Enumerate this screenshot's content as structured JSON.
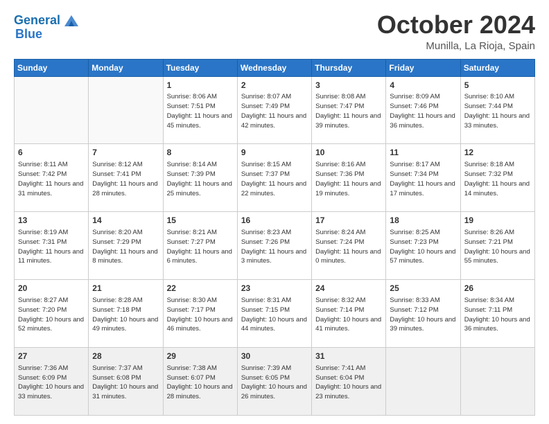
{
  "logo": {
    "line1": "General",
    "line2": "Blue"
  },
  "header": {
    "month": "October 2024",
    "location": "Munilla, La Rioja, Spain"
  },
  "weekdays": [
    "Sunday",
    "Monday",
    "Tuesday",
    "Wednesday",
    "Thursday",
    "Friday",
    "Saturday"
  ],
  "weeks": [
    [
      {
        "day": "",
        "info": ""
      },
      {
        "day": "",
        "info": ""
      },
      {
        "day": "1",
        "info": "Sunrise: 8:06 AM\nSunset: 7:51 PM\nDaylight: 11 hours\nand 45 minutes."
      },
      {
        "day": "2",
        "info": "Sunrise: 8:07 AM\nSunset: 7:49 PM\nDaylight: 11 hours\nand 42 minutes."
      },
      {
        "day": "3",
        "info": "Sunrise: 8:08 AM\nSunset: 7:47 PM\nDaylight: 11 hours\nand 39 minutes."
      },
      {
        "day": "4",
        "info": "Sunrise: 8:09 AM\nSunset: 7:46 PM\nDaylight: 11 hours\nand 36 minutes."
      },
      {
        "day": "5",
        "info": "Sunrise: 8:10 AM\nSunset: 7:44 PM\nDaylight: 11 hours\nand 33 minutes."
      }
    ],
    [
      {
        "day": "6",
        "info": "Sunrise: 8:11 AM\nSunset: 7:42 PM\nDaylight: 11 hours\nand 31 minutes."
      },
      {
        "day": "7",
        "info": "Sunrise: 8:12 AM\nSunset: 7:41 PM\nDaylight: 11 hours\nand 28 minutes."
      },
      {
        "day": "8",
        "info": "Sunrise: 8:14 AM\nSunset: 7:39 PM\nDaylight: 11 hours\nand 25 minutes."
      },
      {
        "day": "9",
        "info": "Sunrise: 8:15 AM\nSunset: 7:37 PM\nDaylight: 11 hours\nand 22 minutes."
      },
      {
        "day": "10",
        "info": "Sunrise: 8:16 AM\nSunset: 7:36 PM\nDaylight: 11 hours\nand 19 minutes."
      },
      {
        "day": "11",
        "info": "Sunrise: 8:17 AM\nSunset: 7:34 PM\nDaylight: 11 hours\nand 17 minutes."
      },
      {
        "day": "12",
        "info": "Sunrise: 8:18 AM\nSunset: 7:32 PM\nDaylight: 11 hours\nand 14 minutes."
      }
    ],
    [
      {
        "day": "13",
        "info": "Sunrise: 8:19 AM\nSunset: 7:31 PM\nDaylight: 11 hours\nand 11 minutes."
      },
      {
        "day": "14",
        "info": "Sunrise: 8:20 AM\nSunset: 7:29 PM\nDaylight: 11 hours\nand 8 minutes."
      },
      {
        "day": "15",
        "info": "Sunrise: 8:21 AM\nSunset: 7:27 PM\nDaylight: 11 hours\nand 6 minutes."
      },
      {
        "day": "16",
        "info": "Sunrise: 8:23 AM\nSunset: 7:26 PM\nDaylight: 11 hours\nand 3 minutes."
      },
      {
        "day": "17",
        "info": "Sunrise: 8:24 AM\nSunset: 7:24 PM\nDaylight: 11 hours\nand 0 minutes."
      },
      {
        "day": "18",
        "info": "Sunrise: 8:25 AM\nSunset: 7:23 PM\nDaylight: 10 hours\nand 57 minutes."
      },
      {
        "day": "19",
        "info": "Sunrise: 8:26 AM\nSunset: 7:21 PM\nDaylight: 10 hours\nand 55 minutes."
      }
    ],
    [
      {
        "day": "20",
        "info": "Sunrise: 8:27 AM\nSunset: 7:20 PM\nDaylight: 10 hours\nand 52 minutes."
      },
      {
        "day": "21",
        "info": "Sunrise: 8:28 AM\nSunset: 7:18 PM\nDaylight: 10 hours\nand 49 minutes."
      },
      {
        "day": "22",
        "info": "Sunrise: 8:30 AM\nSunset: 7:17 PM\nDaylight: 10 hours\nand 46 minutes."
      },
      {
        "day": "23",
        "info": "Sunrise: 8:31 AM\nSunset: 7:15 PM\nDaylight: 10 hours\nand 44 minutes."
      },
      {
        "day": "24",
        "info": "Sunrise: 8:32 AM\nSunset: 7:14 PM\nDaylight: 10 hours\nand 41 minutes."
      },
      {
        "day": "25",
        "info": "Sunrise: 8:33 AM\nSunset: 7:12 PM\nDaylight: 10 hours\nand 39 minutes."
      },
      {
        "day": "26",
        "info": "Sunrise: 8:34 AM\nSunset: 7:11 PM\nDaylight: 10 hours\nand 36 minutes."
      }
    ],
    [
      {
        "day": "27",
        "info": "Sunrise: 7:36 AM\nSunset: 6:09 PM\nDaylight: 10 hours\nand 33 minutes."
      },
      {
        "day": "28",
        "info": "Sunrise: 7:37 AM\nSunset: 6:08 PM\nDaylight: 10 hours\nand 31 minutes."
      },
      {
        "day": "29",
        "info": "Sunrise: 7:38 AM\nSunset: 6:07 PM\nDaylight: 10 hours\nand 28 minutes."
      },
      {
        "day": "30",
        "info": "Sunrise: 7:39 AM\nSunset: 6:05 PM\nDaylight: 10 hours\nand 26 minutes."
      },
      {
        "day": "31",
        "info": "Sunrise: 7:41 AM\nSunset: 6:04 PM\nDaylight: 10 hours\nand 23 minutes."
      },
      {
        "day": "",
        "info": ""
      },
      {
        "day": "",
        "info": ""
      }
    ]
  ]
}
